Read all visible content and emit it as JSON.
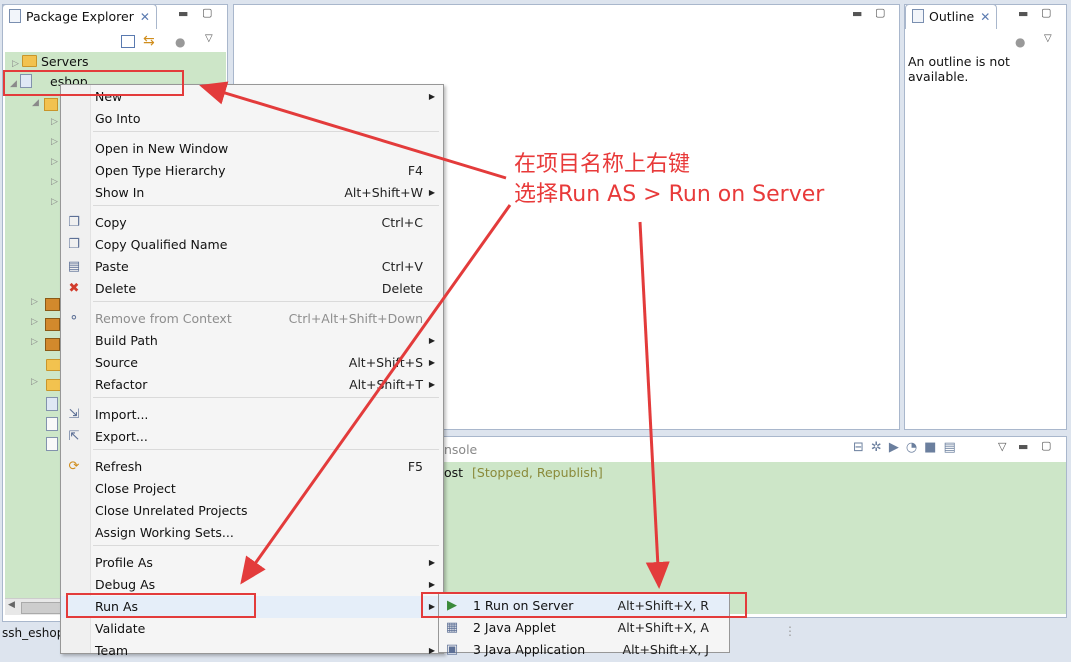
{
  "package_explorer": {
    "tab_title": "Package Explorer",
    "tree_servers": "Servers",
    "tree_project": "eshop"
  },
  "outline": {
    "tab_title": "Outline",
    "message": "An outline is not available."
  },
  "console": {
    "tab_title_partial": "nsole",
    "server_text_partial": "ost",
    "status": "[Stopped, Republish]"
  },
  "status_bar": {
    "project": "ssh_eshop"
  },
  "context_menu": {
    "items": [
      {
        "label": "New",
        "accel": "",
        "submenu": true
      },
      {
        "label": "Go Into",
        "accel": "",
        "submenu": false
      },
      {
        "label": "Open in New Window",
        "accel": "",
        "submenu": false
      },
      {
        "label": "Open Type Hierarchy",
        "accel": "F4",
        "submenu": false
      },
      {
        "label": "Show In",
        "accel": "Alt+Shift+W",
        "submenu": true
      },
      {
        "label": "Copy",
        "accel": "Ctrl+C",
        "submenu": false,
        "icon": "copy-icon"
      },
      {
        "label": "Copy Qualified Name",
        "accel": "",
        "submenu": false,
        "icon": "copy-qualified-icon"
      },
      {
        "label": "Paste",
        "accel": "Ctrl+V",
        "submenu": false,
        "icon": "paste-icon"
      },
      {
        "label": "Delete",
        "accel": "Delete",
        "submenu": false,
        "icon": "delete-icon"
      },
      {
        "label": "Remove from Context",
        "accel": "Ctrl+Alt+Shift+Down",
        "submenu": false,
        "disabled": true,
        "icon": "remove-context-icon"
      },
      {
        "label": "Build Path",
        "accel": "",
        "submenu": true
      },
      {
        "label": "Source",
        "accel": "Alt+Shift+S",
        "submenu": true
      },
      {
        "label": "Refactor",
        "accel": "Alt+Shift+T",
        "submenu": true
      },
      {
        "label": "Import...",
        "accel": "",
        "submenu": false,
        "icon": "import-icon"
      },
      {
        "label": "Export...",
        "accel": "",
        "submenu": false,
        "icon": "export-icon"
      },
      {
        "label": "Refresh",
        "accel": "F5",
        "submenu": false,
        "icon": "refresh-icon"
      },
      {
        "label": "Close Project",
        "accel": "",
        "submenu": false
      },
      {
        "label": "Close Unrelated Projects",
        "accel": "",
        "submenu": false
      },
      {
        "label": "Assign Working Sets...",
        "accel": "",
        "submenu": false
      },
      {
        "label": "Profile As",
        "accel": "",
        "submenu": true
      },
      {
        "label": "Debug As",
        "accel": "",
        "submenu": true
      },
      {
        "label": "Run As",
        "accel": "",
        "submenu": true,
        "selected": true
      },
      {
        "label": "Validate",
        "accel": "",
        "submenu": false
      },
      {
        "label": "Team",
        "accel": "",
        "submenu": true
      }
    ]
  },
  "run_as_submenu": {
    "items": [
      {
        "label": "1 Run on Server",
        "accel": "Alt+Shift+X, R",
        "icon": "run-server-icon"
      },
      {
        "label": "2 Java Applet",
        "accel": "Alt+Shift+X, A",
        "icon": "java-applet-icon"
      },
      {
        "label": "3 Java Application",
        "accel": "Alt+Shift+X, J",
        "icon": "java-app-icon"
      }
    ]
  },
  "annotation": {
    "line1": "在项目名称上右键",
    "line2": "选择Run AS > Run on Server",
    "color": "#e83a3a"
  },
  "colors": {
    "tree_bg": "#cde6c8",
    "console_bg": "#cde6c8",
    "status_text": "#8a8a3a",
    "accent": "#e33b3b"
  }
}
